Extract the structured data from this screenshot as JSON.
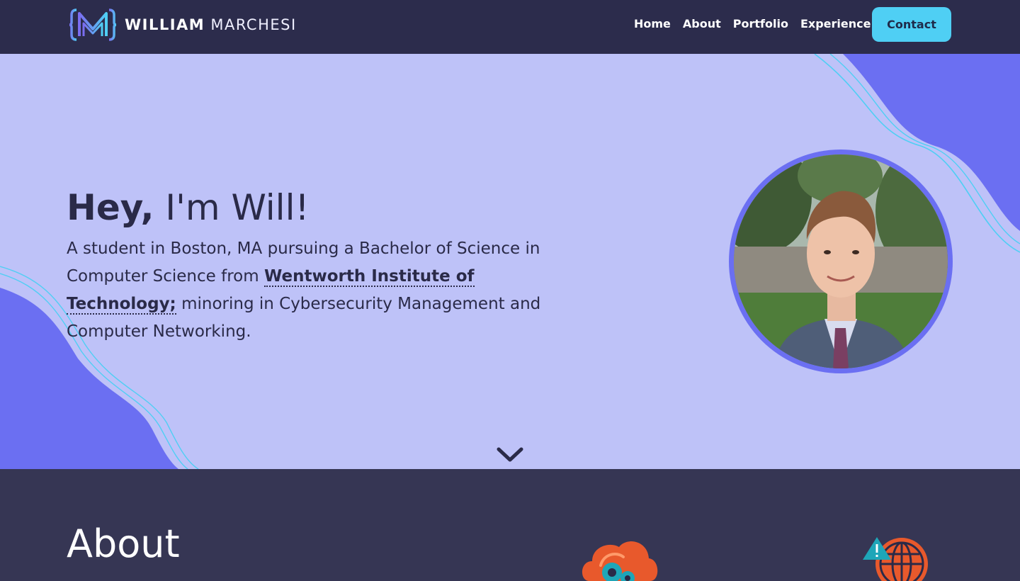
{
  "nav": {
    "logo_first": "WILLIAM",
    "logo_last": "MARCHESI",
    "links": [
      "Home",
      "About",
      "Portfolio",
      "Experience"
    ],
    "contact_label": "Contact"
  },
  "hero": {
    "greeting": "Hey,",
    "greeting_rest": " I'm Will!",
    "intro_part1": "A student in Boston, MA pursuing a Bachelor of Science in Computer Science from ",
    "school": "Wentworth Institute of Technology;",
    "intro_part2": " minoring in Cybersecurity Management and Computer Networking."
  },
  "about": {
    "title": "About"
  },
  "icons": {
    "logo": "wm-logo-icon",
    "scroll": "chevron-down-icon",
    "cloud": "cloud-gear-icon",
    "globe": "globe-warning-icon"
  },
  "colors": {
    "nav_bg": "#2c2c4c",
    "hero_bg": "#bec2f8",
    "accent_purple": "#6b6ff2",
    "accent_cyan": "#4fcff4",
    "about_bg": "#363654"
  }
}
